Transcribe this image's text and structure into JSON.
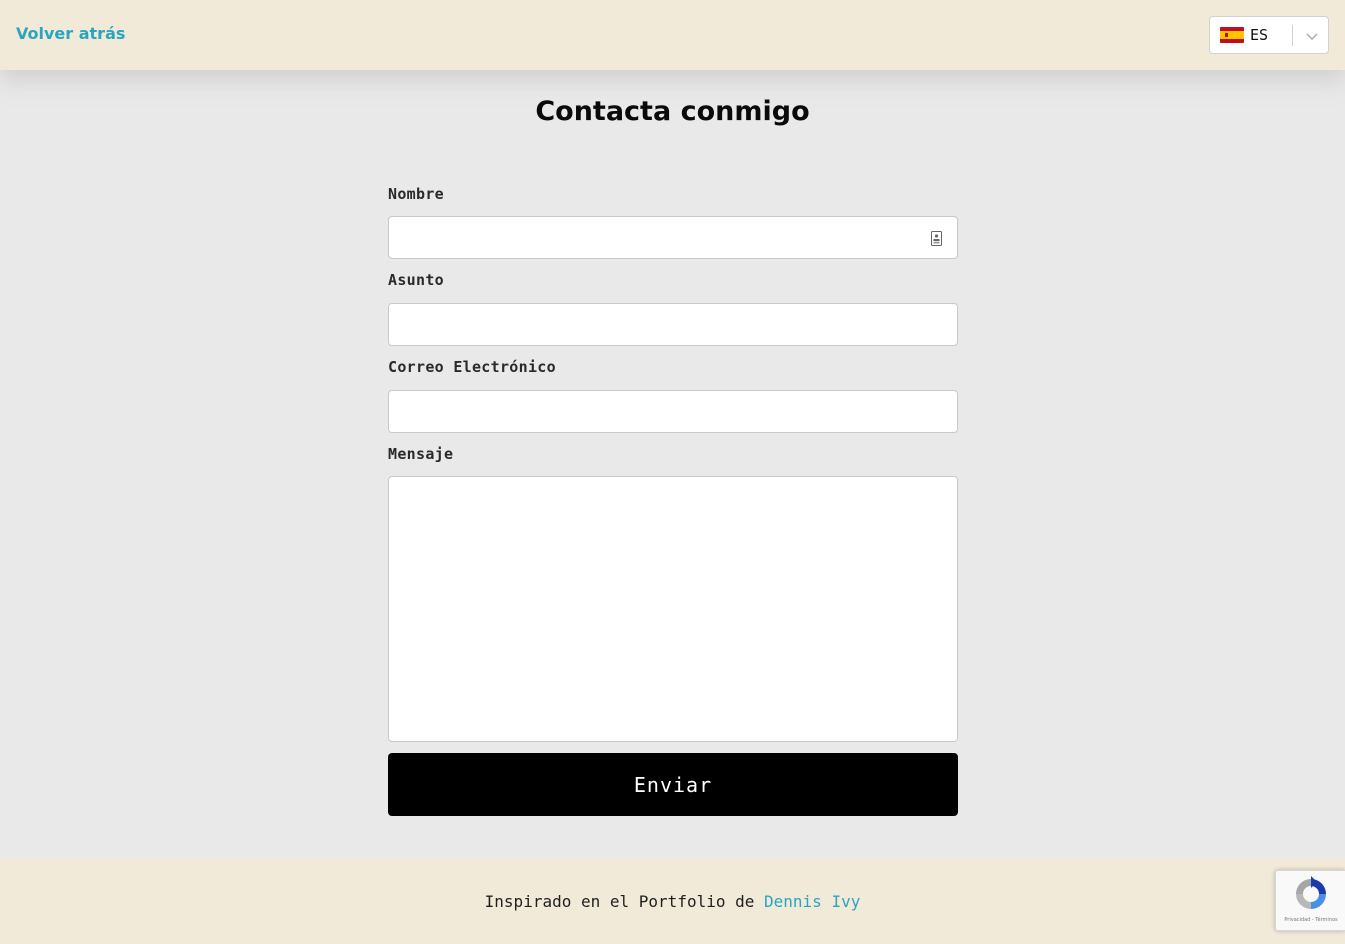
{
  "header": {
    "back_link": "Volver atrás",
    "language": {
      "code": "ES",
      "flag_icon": "spain-flag-icon",
      "dropdown_icon": "chevron-down-icon"
    }
  },
  "main": {
    "title": "Contacta conmigo",
    "form": {
      "fields": [
        {
          "label": "Nombre",
          "value": "",
          "placeholder": ""
        },
        {
          "label": "Asunto",
          "value": "",
          "placeholder": ""
        },
        {
          "label": "Correo Electrónico",
          "value": "",
          "placeholder": ""
        },
        {
          "label": "Mensaje",
          "value": "",
          "placeholder": ""
        }
      ],
      "autofill_icon": "contact-card-icon",
      "submit_label": "Enviar"
    }
  },
  "footer": {
    "text": "Inspirado en el Portfolio de",
    "link_label": "Dennis Ivy"
  },
  "recaptcha": {
    "privacy_label": "Privacidad",
    "separator": " - ",
    "terms_label": "Términos"
  },
  "colors": {
    "accent": "#2aa5bf",
    "header_footer_bg": "#f1ead8",
    "page_bg": "#e9e9e9",
    "button_bg": "#000000"
  }
}
